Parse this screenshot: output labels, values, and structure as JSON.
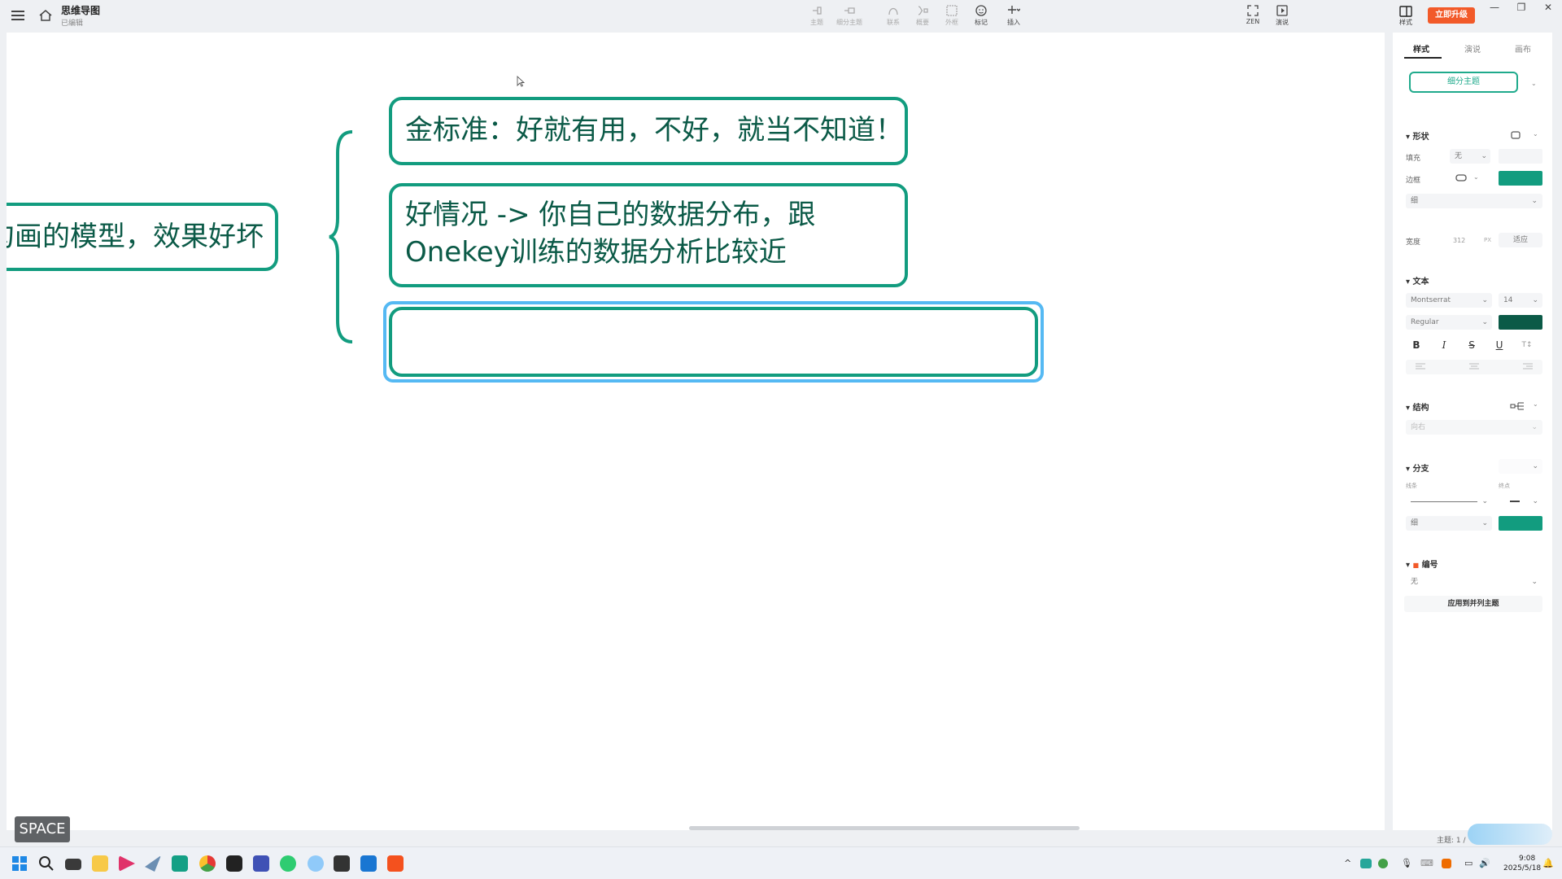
{
  "app": {
    "doc_title": "思维导图",
    "doc_status": "已编辑"
  },
  "toolbar": {
    "items": [
      {
        "label": "主题",
        "icon": "topic-icon"
      },
      {
        "label": "细分主题",
        "icon": "subtopic-icon"
      },
      {
        "label": "联系",
        "icon": "relationship-icon"
      },
      {
        "label": "概要",
        "icon": "summary-icon"
      },
      {
        "label": "外框",
        "icon": "boundary-icon"
      },
      {
        "label": "标记",
        "icon": "marker-icon"
      },
      {
        "label": "插入",
        "icon": "insert-icon"
      }
    ],
    "zen_label": "ZEN",
    "present_label": "演说",
    "style_toggle_label": "样式",
    "upgrade_label": "立即升级"
  },
  "canvas": {
    "root_node_text": "勾画的模型，效果好坏",
    "child_nodes": [
      "金标准：好就有用，不好，就当不知道！",
      "好情况 -> 你自己的数据分布，跟Onekey训练的数据分析比较近",
      ""
    ],
    "key_hint": "SPACE"
  },
  "colors": {
    "accent": "#129c7f",
    "node_text": "#0b5a47",
    "selection": "#55b9f3",
    "upgrade": "#f25a29"
  },
  "panel": {
    "tabs": [
      "样式",
      "演说",
      "画布"
    ],
    "topic_type": "细分主题",
    "shape": {
      "title": "形状",
      "fill_label": "填充",
      "fill_value": "无",
      "border_label": "边框",
      "border_weight": "细",
      "width_label": "宽度",
      "width_value": "312",
      "width_unit": "PX",
      "fit_label": "适应"
    },
    "text": {
      "title": "文本",
      "font": "Montserrat",
      "size": "14",
      "weight": "Regular",
      "bold": "B",
      "italic": "I",
      "strike": "S",
      "underline": "U",
      "case": "T↕"
    },
    "structure": {
      "title": "结构",
      "value": "向右"
    },
    "branch": {
      "title": "分支",
      "line_label": "线条",
      "endpoint_label": "终点",
      "weight": "细"
    },
    "numbering": {
      "title": "编号",
      "value": "无"
    },
    "apply_label": "应用到并列主题",
    "topic_count": "主题: 1 /"
  },
  "taskbar": {
    "time": "9:08",
    "date": "2025/5/18"
  }
}
